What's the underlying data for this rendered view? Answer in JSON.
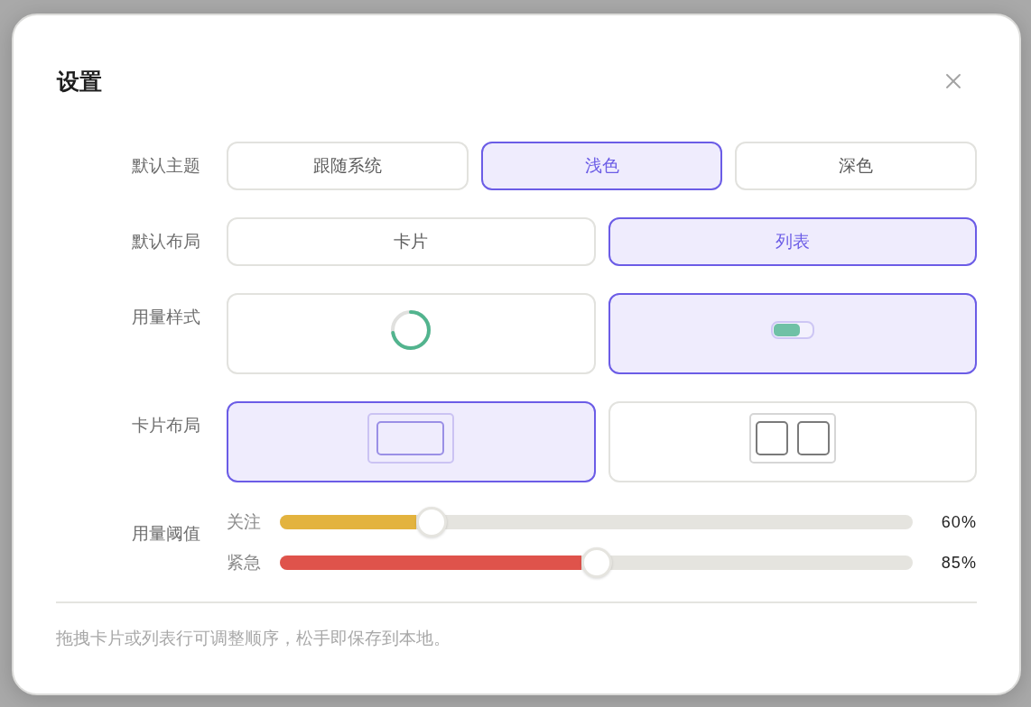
{
  "dialog": {
    "title": "设置"
  },
  "settings": [
    {
      "kind": "text",
      "label": "默认主题",
      "options": [
        {
          "label": "跟随系统",
          "selected": false
        },
        {
          "label": "浅色",
          "selected": true
        },
        {
          "label": "深色",
          "selected": false
        }
      ]
    },
    {
      "kind": "text",
      "label": "默认布局",
      "options": [
        {
          "label": "卡片",
          "selected": false
        },
        {
          "label": "列表",
          "selected": true
        }
      ]
    },
    {
      "kind": "picture",
      "label": "用量样式",
      "options": [
        {
          "kind": "ring",
          "selected": false
        },
        {
          "kind": "bar",
          "selected": true
        }
      ]
    },
    {
      "kind": "picture",
      "label": "卡片布局",
      "options": [
        {
          "kind": "single",
          "selected": true
        },
        {
          "kind": "double",
          "selected": false
        }
      ]
    }
  ],
  "thresholds": {
    "label": "用量阈值",
    "sliders": [
      {
        "name": "关注",
        "level": 0.24,
        "reading": "60%",
        "color": "#e3b33e"
      },
      {
        "name": "紧急",
        "level": 0.5,
        "reading": "85%",
        "color": "#df534b"
      }
    ]
  },
  "footer_note": "拖拽卡片或列表行可调整顺序，松手即保存到本地。"
}
